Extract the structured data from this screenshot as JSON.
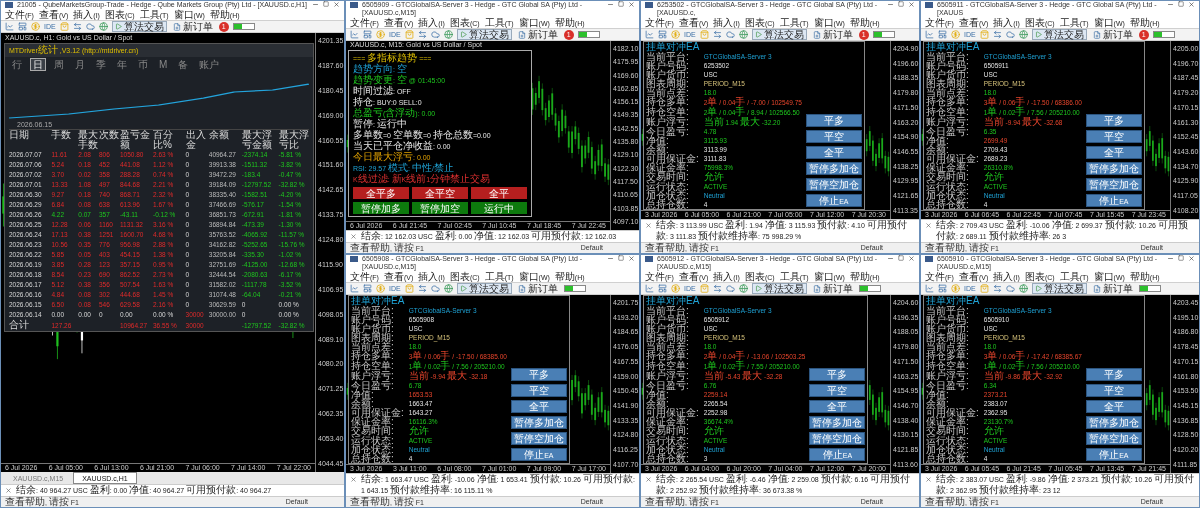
{
  "windows": [
    {
      "kind": "report",
      "title": "21005 - QubeMarketsGroup-Trade - Hedge - Qube Markets Group (Pty) Ltd - [XAUUSD.c,H1]",
      "menu": [
        "文件(F)",
        "查看(V)",
        "插入(I)",
        "图表(C)",
        "工具(T)",
        "窗口(W)",
        "帮助(H)"
      ],
      "toolbar": {
        "ide": "IDE",
        "algo": "算法交易",
        "order": "新订单"
      },
      "alert_count": "1",
      "chart": {
        "symbol": "XAUUSD.c, H1:  Gold vs US Dollar / Spot",
        "price_ticks": [
          "4201.35",
          "4187.60",
          "4180.45",
          "4169.00",
          "4160.55",
          "4151.60",
          "4142.65",
          "4133.75",
          "4124.80",
          "4115.90",
          "4106.95",
          "4098.05",
          "4089.10",
          "4080.20",
          "4071.25",
          "4062.35",
          "4053.40",
          "4044.45"
        ],
        "time_ticks": [
          "6 Jul 2026",
          "6 Jul 05:00",
          "6 Jul 13:00",
          "6 Jul 21:00",
          "7 Jul 06:00",
          "7 Jul 14:00",
          "7 Jul 22:00"
        ],
        "panel": {
          "title": "MTDriver统计 ,V3.12 (http://mtdriver.cn)",
          "periods": [
            {
              "label": "行",
              "selected": false
            },
            {
              "label": "日",
              "selected": true
            },
            {
              "label": "周",
              "selected": false
            },
            {
              "label": "月",
              "selected": false
            },
            {
              "label": "季",
              "selected": false
            },
            {
              "label": "年",
              "selected": false
            },
            {
              "label": "币",
              "selected": false
            },
            {
              "label": "M",
              "selected": false
            },
            {
              "label": "备",
              "selected": false
            },
            {
              "label": "账户",
              "selected": false
            }
          ],
          "curve_date": "2026.06.15",
          "columns": [
            "日期",
            "手数",
            "最大手数",
            "次数",
            "盈亏金额",
            "百分比%",
            "出入金",
            "余额",
            "最大浮亏金额",
            "最大浮亏比"
          ],
          "rows": [
            {
              "kind": "gain",
              "cells": [
                "2026.07.07",
                "11.61",
                "2.08",
                "806",
                "1050.80",
                "2.63 %",
                "0",
                "40964.27",
                "-2374.14",
                "-5.81 %"
              ]
            },
            {
              "kind": "gain",
              "cells": [
                "2026.07.06",
                "5.24",
                "0.18",
                "452",
                "441.08",
                "1.12 %",
                "0",
                "39913.38",
                "-1511.32",
                "-3.82 %"
              ]
            },
            {
              "kind": "gain",
              "cells": [
                "2026.07.02",
                "3.70",
                "0.02",
                "358",
                "288.28",
                "0.74 %",
                "0",
                "39472.29",
                "-183.4",
                "-0.47 %"
              ]
            },
            {
              "kind": "gain",
              "cells": [
                "2026.07.01",
                "13.33",
                "1.08",
                "497",
                "844.68",
                "2.21 %",
                "0",
                "39184.09",
                "-12797.52",
                "-32.82 %"
              ]
            },
            {
              "kind": "gain",
              "cells": [
                "2026.06.30",
                "9.27",
                "0.18",
                "740",
                "868.71",
                "2.32 %",
                "0",
                "38335.40",
                "-1582.51",
                "-4.20 %"
              ]
            },
            {
              "kind": "gain",
              "cells": [
                "2026.06.29",
                "6.84",
                "0.08",
                "638",
                "613.96",
                "1.67 %",
                "0",
                "37466.69",
                "-576.17",
                "-1.54 %"
              ]
            },
            {
              "kind": "loss",
              "cells": [
                "2026.06.26",
                "4.22",
                "0.07",
                "357",
                "-43.11",
                "-0.12 %",
                "0",
                "36851.73",
                "-672.91",
                "-1.81 %"
              ]
            },
            {
              "kind": "gain",
              "cells": [
                "2026.06.25",
                "12.28",
                "0.06",
                "1160",
                "1131.32",
                "3.16 %",
                "0",
                "36894.84",
                "-473.39",
                "-1.30 %"
              ]
            },
            {
              "kind": "gain",
              "cells": [
                "2026.06.24",
                "17.13",
                "0.38",
                "1251",
                "1600.70",
                "4.68 %",
                "0",
                "35763.52",
                "-4065.92",
                "-11.57 %"
              ]
            },
            {
              "kind": "gain",
              "cells": [
                "2026.06.23",
                "10.56",
                "0.35",
                "776",
                "956.98",
                "2.88 %",
                "0",
                "34162.82",
                "-5252.65",
                "-15.76 %"
              ]
            },
            {
              "kind": "gain",
              "cells": [
                "2026.06.22",
                "5.85",
                "0.05",
                "403",
                "454.15",
                "1.38 %",
                "0",
                "33205.84",
                "-335.30",
                "-1.02 %"
              ]
            },
            {
              "kind": "gain",
              "cells": [
                "2026.06.19",
                "3.85",
                "0.28",
                "123",
                "357.15",
                "0.95 %",
                "0",
                "32751.69",
                "-4125.00",
                "-12.68 %"
              ]
            },
            {
              "kind": "gain",
              "cells": [
                "2026.06.18",
                "8.54",
                "0.23",
                "690",
                "862.52",
                "2.73 %",
                "0",
                "32444.54",
                "-2080.63",
                "-6.17 %"
              ]
            },
            {
              "kind": "gain",
              "cells": [
                "2026.06.17",
                "5.12",
                "0.38",
                "356",
                "507.54",
                "1.63 %",
                "0",
                "31582.02",
                "-1117.78",
                "-3.52 %"
              ]
            },
            {
              "kind": "gain",
              "cells": [
                "2026.06.16",
                "4.84",
                "0.08",
                "302",
                "444.68",
                "1.45 %",
                "0",
                "31074.48",
                "-64.04",
                "-0.21 %"
              ]
            },
            {
              "kind": "opening",
              "cells": [
                "2026.06.15",
                "6.50",
                "0.08",
                "546",
                "629.58",
                "2.16 %",
                "0",
                "30629.59",
                "0",
                "0.00 %"
              ]
            },
            {
              "kind": "deposit",
              "cells": [
                "2026.06.14",
                "0.00",
                "0.00",
                "0",
                "0.00",
                "0.00 %",
                "30000",
                "30000.00",
                "0",
                "0.00 %"
              ]
            },
            {
              "kind": "total",
              "cells": [
                "合计",
                "127.26",
                null,
                null,
                "10964.27",
                "36.55 %",
                "30000",
                null,
                "-12797.52",
                "-32.82 %"
              ]
            }
          ]
        }
      },
      "tabs": [
        {
          "label": "XAUUSD.c,M15",
          "selected": false
        },
        {
          "label": "XAUUSD.c,H1",
          "selected": true
        }
      ],
      "status": "结余: 40 964.27 USC  盈利: 0.00  净值: 40 964.27  可用预付款: 40 964.27",
      "help": "查看帮助, 请按 F1",
      "profile": "Default"
    },
    {
      "kind": "trend",
      "title": "6505909 - GTCGlobalSA-Server 3 - Hedge - GTC Global SA (Pty) Ltd - [XAUUSD.c,M15]",
      "menu": [
        "文件(F)",
        "查看(V)",
        "插入(I)",
        "图表(C)",
        "工具(T)",
        "窗口(W)",
        "帮助(H)"
      ],
      "toolbar": {
        "ide": "IDE",
        "algo": "算法交易",
        "order": "新订单"
      },
      "alert_count": "1",
      "chart": {
        "symbol": "XAUUSD.c, M15:  Gold vs US Dollar / Spot",
        "price_ticks": [
          "4182.10",
          "4175.95",
          "4169.60",
          "4162.85",
          "4156.15",
          "4149.35",
          "4142.55",
          "4135.80",
          "4129.10",
          "4122.30",
          "4117.50",
          "4110.65",
          "4103.85",
          "4097.10"
        ],
        "time_ticks": [
          "6 Jul 2026",
          "6 Jul 21:45",
          "7 Jul 02:45",
          "7 Jul 10:45",
          "7 Jul 18:45",
          "7 Jul 22:45"
        ],
        "panel": {
          "lines": [
            {
              "kind": "header",
              "text": "===  多指标趋势  ==="
            },
            {
              "kind": "info",
              "text": "趋势方向: 空"
            },
            {
              "kind": "profit",
              "text": "趋势变更: 空 @ 01:45:00"
            },
            {
              "kind": "plain",
              "text": "时间过滤: OFF"
            },
            {
              "kind": "plain",
              "text": "持仓: BUY:0   SELL:0"
            },
            {
              "kind": "profit",
              "text": "总盈亏(含浮动): 0.00"
            },
            {
              "kind": "plain",
              "text": "暂停: 运行中"
            },
            {
              "kind": "plain",
              "text": "多单数=0 空单数=0 持仓总数=0.00"
            },
            {
              "kind": "plain",
              "text": "当天已平仓净收益: 0.00"
            },
            {
              "kind": "warning",
              "text": "今日最大浮亏: 0.00"
            },
            {
              "kind": "info",
              "text": "RSI: 29.57   模式: 中性/禁止"
            },
            {
              "kind": "alert",
              "text": "K线过滤: 新K线前1分钟禁止交易"
            }
          ],
          "buttons": [
            {
              "label": "全平多",
              "color": "#b51f1f"
            },
            {
              "label": "全平空",
              "color": "#b51f1f"
            },
            {
              "label": "全平",
              "color": "#b51f1f"
            },
            {
              "label": "暂停加多",
              "color": "#0d7a0d"
            },
            {
              "label": "暂停加空",
              "color": "#0d7a0d"
            },
            {
              "label": "运行中",
              "color": "#0d7a0d"
            }
          ]
        }
      },
      "status": "结余: 12 162.03 USC  盈利: 0.00  净值: 12 162.03  可用预付款: 12 162.03",
      "help": "查看帮助, 请按 F1",
      "profile": "Default"
    },
    {
      "kind": "hedge",
      "title": "6253502 - GTCGlobalSA-Server 3 - Hedge - GTC Global SA (Pty) Ltd - [XAUUSD.c,",
      "menu": [
        "文件(F)",
        "查看(V)",
        "插入(I)",
        "图表(C)",
        "工具(T)",
        "窗口(W)",
        "帮助(H)"
      ],
      "toolbar": {
        "ide": "IDE",
        "algo": "算法交易",
        "order": "新订单"
      },
      "alert_count": "1",
      "chart": {
        "price_ticks": [
          "4204.90",
          "4196.60",
          "4188.35",
          "4179.80",
          "4171.50",
          "4163.20",
          "4154.90",
          "4146.55",
          "4138.25",
          "4129.95",
          "4121.65",
          "4113.35"
        ],
        "time_ticks": [
          "3 Jul 2026",
          "6 Jul 05:00",
          "6 Jul 21:00",
          "7 Jul 05:00",
          "7 Jul 12:00",
          "7 Jul 20:30"
        ],
        "panel": {
          "title": "挂单对冲EA",
          "rows": [
            {
              "label": "当前平台:",
              "value": "GTCGlobalSA-Server 3",
              "kind": "info"
            },
            {
              "label": "账户号码:",
              "value": "6253502",
              "kind": "plain"
            },
            {
              "label": "账户货币:",
              "value": "USC",
              "kind": "plain"
            },
            {
              "label": "图表周期:",
              "value": "PERIOD_M15",
              "kind": "setting"
            },
            {
              "label": "当前点差:",
              "value": "18.0",
              "kind": "profit"
            },
            {
              "label": "持仓多单:",
              "value": "2单 / 0.04手 / -7.00 / 102549.75",
              "kind": "loss"
            },
            {
              "label": "持仓空单:",
              "value": "2单 / 0.04手 / 8.94 / 102566.50",
              "kind": "profit"
            },
            {
              "label": "账户浮亏:",
              "value": "当前 1.94  最大 -32.20",
              "kind": "profit"
            },
            {
              "label": "今日盈亏:",
              "value": "4.78",
              "kind": "profit"
            },
            {
              "label": "净值:",
              "value": "3115.93",
              "kind": "profit"
            },
            {
              "label": "余额:",
              "value": "3113.99",
              "kind": "plain"
            },
            {
              "label": "可用保证金:",
              "value": "3111.83",
              "kind": "plain"
            },
            {
              "label": "保证金率:",
              "value": "75998.3%",
              "kind": "profit"
            },
            {
              "label": "交易时间:",
              "value": "允许",
              "kind": "profit"
            },
            {
              "label": "运行状态:",
              "value": "ACTIVE",
              "kind": "profit"
            },
            {
              "label": "加仓状态:",
              "value": "Neutral",
              "kind": "info"
            },
            {
              "label": "总持仓数:",
              "value": "4",
              "kind": "plain"
            }
          ],
          "buttons": [
            {
              "label": "平多"
            },
            {
              "label": "平空"
            },
            {
              "label": "全平"
            },
            {
              "label": "暂停多加仓"
            },
            {
              "label": "暂停空加仓"
            },
            {
              "label": "停止EA"
            }
          ]
        }
      },
      "status": "结余: 3 113.99 USC  盈利: 1.94  净值: 3 115.93  预付款: 4.10  可用预付款: 3 111.83  预付款维持率: 75 998.29 %",
      "help": "查看帮助, 请按 F1",
      "profile": "Default"
    },
    {
      "kind": "hedge",
      "title": "6505911 - GTCGlobalSA-Server 3 - Hedge - GTC Global SA (Pty) Ltd - [XAUUS",
      "menu": [
        "文件(F)",
        "查看(V)",
        "插入(I)",
        "图表(C)",
        "工具(T)",
        "窗口(W)",
        "帮助(H)"
      ],
      "toolbar": {
        "ide": "IDE",
        "algo": "算法交易",
        "order": "新订单"
      },
      "alert_count": "1",
      "chart": {
        "price_ticks": [
          "4205.00",
          "4196.70",
          "4187.45",
          "4179.20",
          "4170.15",
          "4161.30",
          "4152.45",
          "4143.60",
          "4134.70",
          "4125.90",
          "4117.05",
          "4108.20"
        ],
        "time_ticks": [
          "3 Jul 2026",
          "6 Jul 06:45",
          "6 Jul 22:45",
          "7 Jul 07:45",
          "7 Jul 15:45",
          "7 Jul 23:45"
        ],
        "panel": {
          "title": "挂单对冲EA",
          "rows": [
            {
              "label": "当前平台:",
              "value": "GTCGlobalSA-Server 3",
              "kind": "info"
            },
            {
              "label": "账户号码:",
              "value": "6505911",
              "kind": "plain"
            },
            {
              "label": "账户货币:",
              "value": "USC",
              "kind": "plain"
            },
            {
              "label": "图表周期:",
              "value": "PERIOD_M15",
              "kind": "setting"
            },
            {
              "label": "当前点差:",
              "value": "18.0",
              "kind": "profit"
            },
            {
              "label": "持仓多单:",
              "value": "3单 / 0.06手 / -17.50 / 68386.00",
              "kind": "loss"
            },
            {
              "label": "持仓空单:",
              "value": "1单 / 0.02手 / 7.56 / 205210.00",
              "kind": "profit"
            },
            {
              "label": "账户浮亏:",
              "value": "当前 -9.94  最大 -32.68",
              "kind": "loss"
            },
            {
              "label": "今日盈亏:",
              "value": "6.35",
              "kind": "profit"
            },
            {
              "label": "净值:",
              "value": "2699.49",
              "kind": "loss"
            },
            {
              "label": "余额:",
              "value": "2709.43",
              "kind": "plain"
            },
            {
              "label": "可用保证金:",
              "value": "2689.23",
              "kind": "plain"
            },
            {
              "label": "保证金率:",
              "value": "26310.8%",
              "kind": "profit"
            },
            {
              "label": "交易时间:",
              "value": "允许",
              "kind": "profit"
            },
            {
              "label": "运行状态:",
              "value": "ACTIVE",
              "kind": "profit"
            },
            {
              "label": "加仓状态:",
              "value": "Neutral",
              "kind": "info"
            },
            {
              "label": "总持仓数:",
              "value": "4",
              "kind": "plain"
            }
          ],
          "buttons": [
            {
              "label": "平多"
            },
            {
              "label": "平空"
            },
            {
              "label": "全平"
            },
            {
              "label": "暂停多加仓"
            },
            {
              "label": "暂停空加仓"
            },
            {
              "label": "停止EA"
            }
          ]
        }
      },
      "status": "结余: 2 709.43 USC  盈利: -10.06  净值: 2 699.37  预付款: 10.26  可用预付款: 2 689.11  预付款维持率: 26 3",
      "help": "查看帮助, 请按 F1",
      "profile": "Default"
    },
    {
      "kind": "hedge",
      "title": "6505908 - GTCGlobalSA-Server 3 - Hedge - GTC Global SA (Pty) Ltd - [XAUUSD.c,M15]",
      "menu": [
        "文件(F)",
        "查看(V)",
        "插入(I)",
        "图表(C)",
        "工具(T)",
        "窗口(W)",
        "帮助(H)"
      ],
      "toolbar": {
        "ide": "IDE",
        "algo": "算法交易",
        "order": "新订单"
      },
      "chart": {
        "price_ticks": [
          "4201.75",
          "4193.20",
          "4184.65",
          "4176.05",
          "4167.55",
          "4159.00",
          "4150.45",
          "4141.90",
          "4133.35",
          "4124.80",
          "4116.25",
          "4107.70"
        ],
        "time_ticks": [
          "3 Jul 2026",
          "3 Jul 11:00",
          "6 Jul 08:00",
          "7 Jul 01:00",
          "7 Jul 09:00",
          "7 Jul 17:00"
        ],
        "panel": {
          "title": "挂单对冲EA",
          "rows": [
            {
              "label": "当前平台:",
              "value": "GTCGlobalSA-Server 3",
              "kind": "info"
            },
            {
              "label": "账户号码:",
              "value": "6505908",
              "kind": "plain"
            },
            {
              "label": "账户货币:",
              "value": "USC",
              "kind": "plain"
            },
            {
              "label": "图表周期:",
              "value": "PERIOD_M15",
              "kind": "setting"
            },
            {
              "label": "当前点差:",
              "value": "18.0",
              "kind": "profit"
            },
            {
              "label": "持仓多单:",
              "value": "3单 / 0.06手 / -17.50 / 68385.00",
              "kind": "loss"
            },
            {
              "label": "持仓空单:",
              "value": "1单 / 0.02手 / 7.56 / 205210.00",
              "kind": "profit"
            },
            {
              "label": "账户浮亏:",
              "value": "当前 -9.94  最大 -32.18",
              "kind": "loss"
            },
            {
              "label": "今日盈亏:",
              "value": "6.78",
              "kind": "profit"
            },
            {
              "label": "净值:",
              "value": "1653.53",
              "kind": "loss"
            },
            {
              "label": "余额:",
              "value": "1663.47",
              "kind": "plain"
            },
            {
              "label": "可用保证金:",
              "value": "1643.27",
              "kind": "plain"
            },
            {
              "label": "保证金率:",
              "value": "16116.3%",
              "kind": "profit"
            },
            {
              "label": "交易时间:",
              "value": "允许",
              "kind": "profit"
            },
            {
              "label": "运行状态:",
              "value": "ACTIVE",
              "kind": "profit"
            },
            {
              "label": "加仓状态:",
              "value": "Neutral",
              "kind": "info"
            },
            {
              "label": "总持仓数:",
              "value": "4",
              "kind": "plain"
            }
          ],
          "buttons": [
            {
              "label": "平多"
            },
            {
              "label": "平空"
            },
            {
              "label": "全平"
            },
            {
              "label": "暂停多加仓"
            },
            {
              "label": "暂停空加仓"
            },
            {
              "label": "停止EA"
            }
          ]
        }
      },
      "status": "结余: 1 663.47 USC  盈利: -10.06  净值: 1 653.41  预付款: 10.26  可用预付款: 1 643.15  预付款维持率: 16 115.11 %",
      "help": "查看帮助, 请按 F1",
      "profile": "Default"
    },
    {
      "kind": "hedge",
      "title": "6505912 - GTCGlobalSA-Server 3 - Hedge - GTC Global SA (Pty) Ltd - [XAUUSD.c,M15]",
      "menu": [
        "文件(F)",
        "查看(V)",
        "插入(I)",
        "图表(C)",
        "工具(T)",
        "窗口(W)",
        "帮助(H)"
      ],
      "toolbar": {
        "ide": "IDE",
        "algo": "算法交易",
        "order": "新订单"
      },
      "chart": {
        "price_ticks": [
          "4204.60",
          "4196.35",
          "4188.05",
          "4179.80",
          "4171.50",
          "4163.25",
          "4154.95",
          "4146.70",
          "4138.40",
          "4130.15",
          "4121.85",
          "4113.60"
        ],
        "time_ticks": [
          "3 Jul 2026",
          "6 Jul 04:00",
          "6 Jul 20:00",
          "7 Jul 04:00",
          "7 Jul 12:00",
          "7 Jul 20:00"
        ],
        "panel": {
          "title": "挂单对冲EA",
          "rows": [
            {
              "label": "当前平台:",
              "value": "GTCGlobalSA-Server 3",
              "kind": "info"
            },
            {
              "label": "账户号码:",
              "value": "6505912",
              "kind": "plain"
            },
            {
              "label": "账户货币:",
              "value": "USC",
              "kind": "plain"
            },
            {
              "label": "图表周期:",
              "value": "PERIOD_M15",
              "kind": "setting"
            },
            {
              "label": "当前点差:",
              "value": "18.0",
              "kind": "profit"
            },
            {
              "label": "持仓多单:",
              "value": "2单 / 0.04手 / -13.06 / 102503.25",
              "kind": "loss"
            },
            {
              "label": "持仓空单:",
              "value": "1单 / 0.02手 / 7.55 / 205210.00",
              "kind": "profit"
            },
            {
              "label": "账户浮亏:",
              "value": "当前 -5.43  最大 -32.28",
              "kind": "loss"
            },
            {
              "label": "今日盈亏:",
              "value": "6.76",
              "kind": "profit"
            },
            {
              "label": "净值:",
              "value": "2259.14",
              "kind": "loss"
            },
            {
              "label": "余额:",
              "value": "2265.54",
              "kind": "plain"
            },
            {
              "label": "可用保证金:",
              "value": "2252.98",
              "kind": "plain"
            },
            {
              "label": "保证金率:",
              "value": "36674.4%",
              "kind": "profit"
            },
            {
              "label": "交易时间:",
              "value": "允许",
              "kind": "profit"
            },
            {
              "label": "运行状态:",
              "value": "ACTIVE",
              "kind": "profit"
            },
            {
              "label": "加仓状态:",
              "value": "Neutral",
              "kind": "info"
            },
            {
              "label": "总持仓数:",
              "value": "3",
              "kind": "plain"
            }
          ],
          "buttons": [
            {
              "label": "平多"
            },
            {
              "label": "平空"
            },
            {
              "label": "全平"
            },
            {
              "label": "暂停多加仓"
            },
            {
              "label": "暂停空加仓"
            },
            {
              "label": "停止EA"
            }
          ]
        }
      },
      "status": "结余: 2 265.54 USC  盈利: -6.46  净值: 2 259.08  预付款: 6.16  可用预付款: 2 252.92  预付款维持率: 36 673.38 %",
      "help": "查看帮助, 请按 F1",
      "profile": "Default"
    },
    {
      "kind": "hedge",
      "title": "6505910 - GTCGlobalSA-Server 3 - Hedge - GTC Global SA (Pty) Ltd - [XAUUSD.c,M15]",
      "menu": [
        "文件(F)",
        "查看(V)",
        "插入(I)",
        "图表(C)",
        "工具(T)",
        "窗口(W)",
        "帮助(H)"
      ],
      "toolbar": {
        "ide": "IDE",
        "algo": "算法交易",
        "order": "新订单"
      },
      "chart": {
        "price_ticks": [
          "4203.45",
          "4195.10",
          "4186.80",
          "4178.45",
          "4170.15",
          "4161.80",
          "4153.50",
          "4145.15",
          "4136.85",
          "4128.50",
          "4120.20",
          "4111.85"
        ],
        "time_ticks": [
          "3 Jul 2026",
          "6 Jul 05:45",
          "6 Jul 21:45",
          "7 Jul 05:45",
          "7 Jul 13:45",
          "7 Jul 21:45"
        ],
        "panel": {
          "title": "挂单对冲EA",
          "rows": [
            {
              "label": "当前平台:",
              "value": "GTCGlobalSA-Server 3",
              "kind": "info"
            },
            {
              "label": "账户号码:",
              "value": "6505910",
              "kind": "plain"
            },
            {
              "label": "账户货币:",
              "value": "USC",
              "kind": "plain"
            },
            {
              "label": "图表周期:",
              "value": "PERIOD_M15",
              "kind": "setting"
            },
            {
              "label": "当前点差:",
              "value": "18.0",
              "kind": "profit"
            },
            {
              "label": "持仓多单:",
              "value": "3单 / 0.06手 / -17.42 / 68385.67",
              "kind": "loss"
            },
            {
              "label": "持仓空单:",
              "value": "1单 / 0.02手 / 7.56 / 205210.00",
              "kind": "profit"
            },
            {
              "label": "账户浮亏:",
              "value": "当前 -9.86  最大 -32.92",
              "kind": "loss"
            },
            {
              "label": "今日盈亏:",
              "value": "6.34",
              "kind": "profit"
            },
            {
              "label": "净值:",
              "value": "2373.21",
              "kind": "loss"
            },
            {
              "label": "余额:",
              "value": "2383.07",
              "kind": "plain"
            },
            {
              "label": "可用保证金:",
              "value": "2362.95",
              "kind": "plain"
            },
            {
              "label": "保证金率:",
              "value": "23130.7%",
              "kind": "profit"
            },
            {
              "label": "交易时间:",
              "value": "允许",
              "kind": "profit"
            },
            {
              "label": "运行状态:",
              "value": "ACTIVE",
              "kind": "profit"
            },
            {
              "label": "加仓状态:",
              "value": "Neutral",
              "kind": "info"
            },
            {
              "label": "总持仓数:",
              "value": "4",
              "kind": "plain"
            }
          ],
          "buttons": [
            {
              "label": "平多"
            },
            {
              "label": "平空"
            },
            {
              "label": "全平"
            },
            {
              "label": "暂停多加仓"
            },
            {
              "label": "暂停空加仓"
            },
            {
              "label": "停止EA"
            }
          ]
        }
      },
      "status": "结余: 2 383.07 USC  盈利: -9.86  净值: 2 373.21  预付款: 10.26  可用预付款: 2 362.95  预付款维持率: 23 12",
      "help": "查看帮助, 请按 F1",
      "profile": "Default"
    }
  ]
}
